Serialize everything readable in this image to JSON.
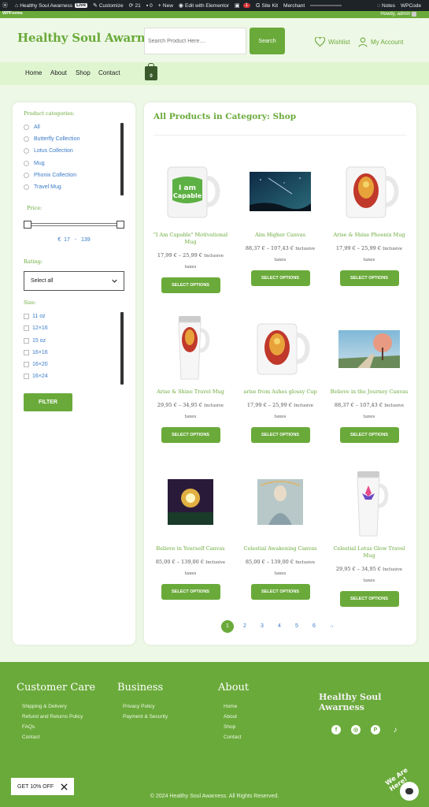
{
  "admin_bar": {
    "site_name": "Healthy Soul Awarness",
    "live": "Live",
    "customize": "Customize",
    "updates": "21",
    "comments": "0",
    "new": "New",
    "edit": "Edit with Elementor",
    "seo_badge": "1",
    "site_kit": "Site Kit",
    "merchant": "Merchant",
    "notes": "Notes",
    "wpcode": "WPCode",
    "howdy": "Howdy, admin"
  },
  "forms_bar": {
    "label": "WPForms"
  },
  "header": {
    "logo": "Healthy Soul Awarness",
    "search_placeholder": "Search Product Here....",
    "search_button": "Search",
    "wishlist": "Wishlist",
    "account": "My Account"
  },
  "nav": {
    "items": [
      "Home",
      "About",
      "Shop",
      "Contact"
    ],
    "cart_count": "0"
  },
  "sidebar": {
    "categories_title": "Product categories:",
    "categories": [
      "All",
      "Butterfly Collection",
      "Lotus Collection",
      "Mug",
      "Phonix Collection",
      "Travel Mug"
    ],
    "price_title": "Price:",
    "price_currency": "€",
    "price_min": "17",
    "price_sep": "-",
    "price_max": "139",
    "rating_title": "Rating:",
    "rating_value": "Select all",
    "size_title": "Size:",
    "sizes": [
      "11 oz",
      "12×16",
      "15 oz",
      "16×16",
      "16×20",
      "16×24"
    ],
    "filter_button": "FILTER"
  },
  "main": {
    "title": "All Products in Category: Shop",
    "products": [
      {
        "name": "\"I Am Capable\" Motivational Mug",
        "price": "17,99 € – 25,99 €",
        "tax": "Inclusive taxes",
        "button": "SELECT OPTIONS",
        "image": "capable-mug"
      },
      {
        "name": "Aim Higher Canvas",
        "price": "88,37 € – 107,43 €",
        "tax": "Inclusive taxes",
        "button": "SELECT OPTIONS",
        "image": "night-canvas"
      },
      {
        "name": "Arise & Shine Phoenix Mug",
        "price": "17,99 € – 25,99 €",
        "tax": "Inclusive taxes",
        "button": "SELECT OPTIONS",
        "image": "phoenix-mug"
      },
      {
        "name": "Arise & Shine Travel Mug",
        "price": "29,95 € – 34,95 €",
        "tax": "Inclusive taxes",
        "button": "SELECT OPTIONS",
        "image": "phoenix-travel-mug"
      },
      {
        "name": "arise from Ashes glossy Cup",
        "price": "17,99 € – 25,99 €",
        "tax": "Inclusive taxes",
        "button": "SELECT OPTIONS",
        "image": "phoenix-mug"
      },
      {
        "name": "Believe in the Journey Canvas",
        "price": "88,37 € – 107,43 €",
        "tax": "Inclusive taxes",
        "button": "SELECT OPTIONS",
        "image": "tree-canvas"
      },
      {
        "name": "Believe in Yourself Canvas",
        "price": "85,00 € – 139,00 €",
        "tax": "Inclusive taxes",
        "button": "SELECT OPTIONS",
        "image": "believe-canvas"
      },
      {
        "name": "Celestial Awakening Canvas",
        "price": "85,00 € – 139,00 €",
        "tax": "Inclusive taxes",
        "button": "SELECT OPTIONS",
        "image": "celestial-canvas"
      },
      {
        "name": "Celestial Lotus Glow Travel Mug",
        "price": "29,95 € – 34,95 €",
        "tax": "Inclusive taxes",
        "button": "SELECT OPTIONS",
        "image": "lotus-travel-mug"
      }
    ],
    "pagination": [
      "1",
      "2",
      "3",
      "4",
      "5",
      "6",
      "→"
    ],
    "current_page": "1"
  },
  "footer": {
    "customer_care_title": "Customer Care",
    "customer_care_links": [
      "Shipping & Delivery",
      "Refund and Returns Policy",
      "FAQs",
      "Contact"
    ],
    "business_title": "Business",
    "business_links": [
      "Privacy Policy",
      "Payment & Security"
    ],
    "about_title": "About",
    "about_links": [
      "Home",
      "About",
      "Shop",
      "Contact"
    ],
    "logo": "Healthy Soul Awarness",
    "social": [
      "facebook-icon",
      "instagram-icon",
      "pinterest-icon",
      "tiktok-icon"
    ],
    "copyright": "© 2024 Healthy Soul Awarness. All Rights Reserved.",
    "promo": "GET 10% OFF",
    "chat_label": "We Are Here!"
  },
  "colors": {
    "brand_green": "#6aaa3a",
    "nav_bg": "#dff5cf",
    "page_bg": "#eef8e6",
    "link_blue": "#3a7bc8"
  }
}
